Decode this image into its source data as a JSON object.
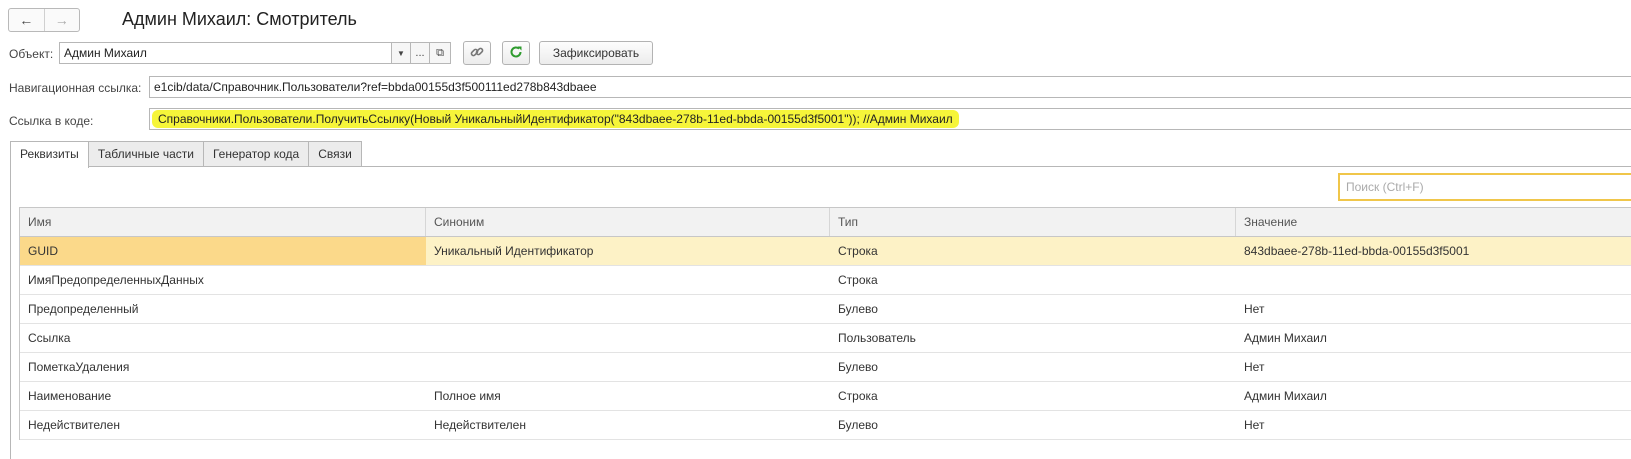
{
  "window": {
    "title": "Админ Михаил: Смотритель",
    "back_icon": "arrow-left-icon",
    "forward_icon": "arrow-right-icon"
  },
  "object": {
    "label": "Объект:",
    "value": "Админ Михаил",
    "fix_button": "Зафиксировать"
  },
  "nav_link": {
    "label": "Навигационная ссылка:",
    "value": "e1cib/data/Справочник.Пользователи?ref=bbda00155d3f500111ed278b843dbaee"
  },
  "code_link": {
    "label": "Ссылка в коде:",
    "value": "Справочники.Пользователи.ПолучитьСсылку(Новый УникальныйИдентификатор(\"843dbaee-278b-11ed-bbda-00155d3f5001\")); //Админ Михаил",
    "highlight_color": "#f6f53a"
  },
  "tabs": [
    {
      "label": "Реквизиты",
      "active": true
    },
    {
      "label": "Табличные части",
      "active": false
    },
    {
      "label": "Генератор кода",
      "active": false
    },
    {
      "label": "Связи",
      "active": false
    }
  ],
  "search": {
    "placeholder": "Поиск (Ctrl+F)"
  },
  "table": {
    "columns": [
      "Имя",
      "Синоним",
      "Тип",
      "Значение"
    ],
    "rows": [
      [
        "GUID",
        "Уникальный Идентификатор",
        "Строка",
        "843dbaee-278b-11ed-bbda-00155d3f5001"
      ],
      [
        "ИмяПредопределенныхДанных",
        "",
        "Строка",
        ""
      ],
      [
        "Предопределенный",
        "",
        "Булево",
        "Нет"
      ],
      [
        "Ссылка",
        "",
        "Пользователь",
        "Админ Михаил"
      ],
      [
        "ПометкаУдаления",
        "",
        "Булево",
        "Нет"
      ],
      [
        "Наименование",
        "Полное имя",
        "Строка",
        "Админ Михаил"
      ],
      [
        "Недействителен",
        "Недействителен",
        "Булево",
        "Нет"
      ]
    ],
    "selected_row": 0
  }
}
